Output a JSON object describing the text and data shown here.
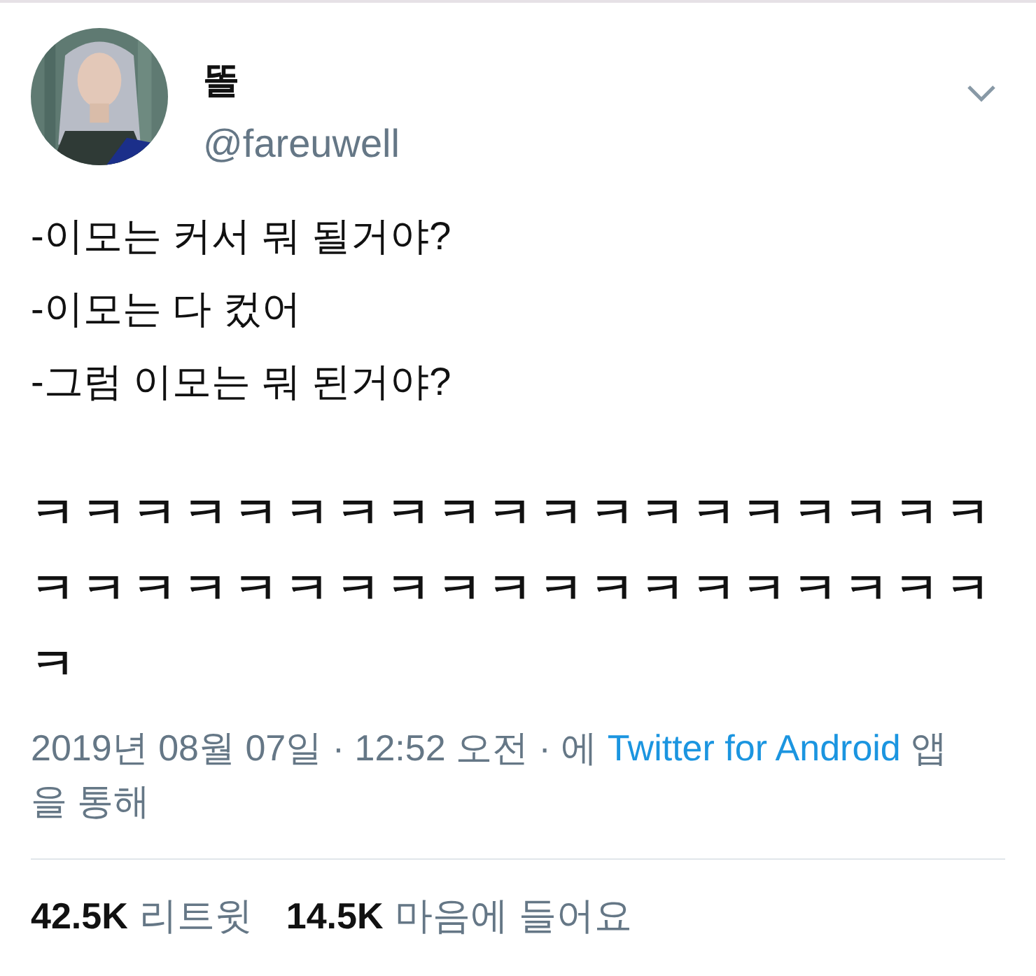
{
  "author": {
    "name": "똘",
    "handle": "@fareuwell"
  },
  "body_lines": [
    "-이모는 커서 뭐 될거야?",
    "-이모는 다 컸어",
    "-그럼 이모는 뭐 된거야?"
  ],
  "laugh_lines": [
    "ㅋㅋㅋㅋㅋㅋㅋㅋㅋㅋㅋㅋㅋㅋㅋㅋㅋㅋㅋ",
    "ㅋㅋㅋㅋㅋㅋㅋㅋㅋㅋㅋㅋㅋㅋㅋㅋㅋㅋㅋ",
    "ㅋ"
  ],
  "meta": {
    "before": "2019년 08월 07일 · 12:52 오전 · 에",
    "source": "Twitter for Android",
    "after": "앱을 통해"
  },
  "stats": [
    {
      "count": "42.5K",
      "label": "리트윗"
    },
    {
      "count": "14.5K",
      "label": "마음에 들어요"
    }
  ]
}
